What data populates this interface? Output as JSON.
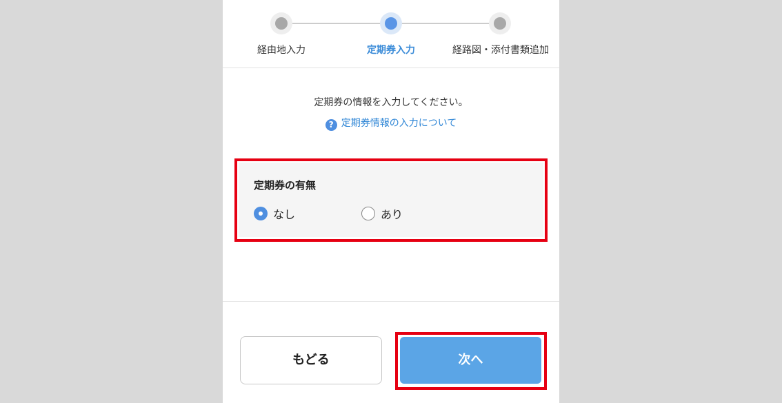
{
  "steps": [
    {
      "label": "経由地入力",
      "state": "inactive"
    },
    {
      "label": "定期券入力",
      "state": "active"
    },
    {
      "label": "経路図・添付書類追加",
      "state": "inactive"
    }
  ],
  "instruction": "定期券の情報を入力してください。",
  "help_link": {
    "icon": "?",
    "label": "定期券情報の入力について"
  },
  "pass_section": {
    "title": "定期券の有無",
    "options": [
      {
        "label": "なし",
        "checked": true
      },
      {
        "label": "あり",
        "checked": false
      }
    ]
  },
  "buttons": {
    "back": "もどる",
    "next": "次へ"
  },
  "colors": {
    "accent": "#5a95e6",
    "next_button": "#5ba5e6",
    "highlight_border": "#e60012",
    "link": "#2f86d6"
  }
}
